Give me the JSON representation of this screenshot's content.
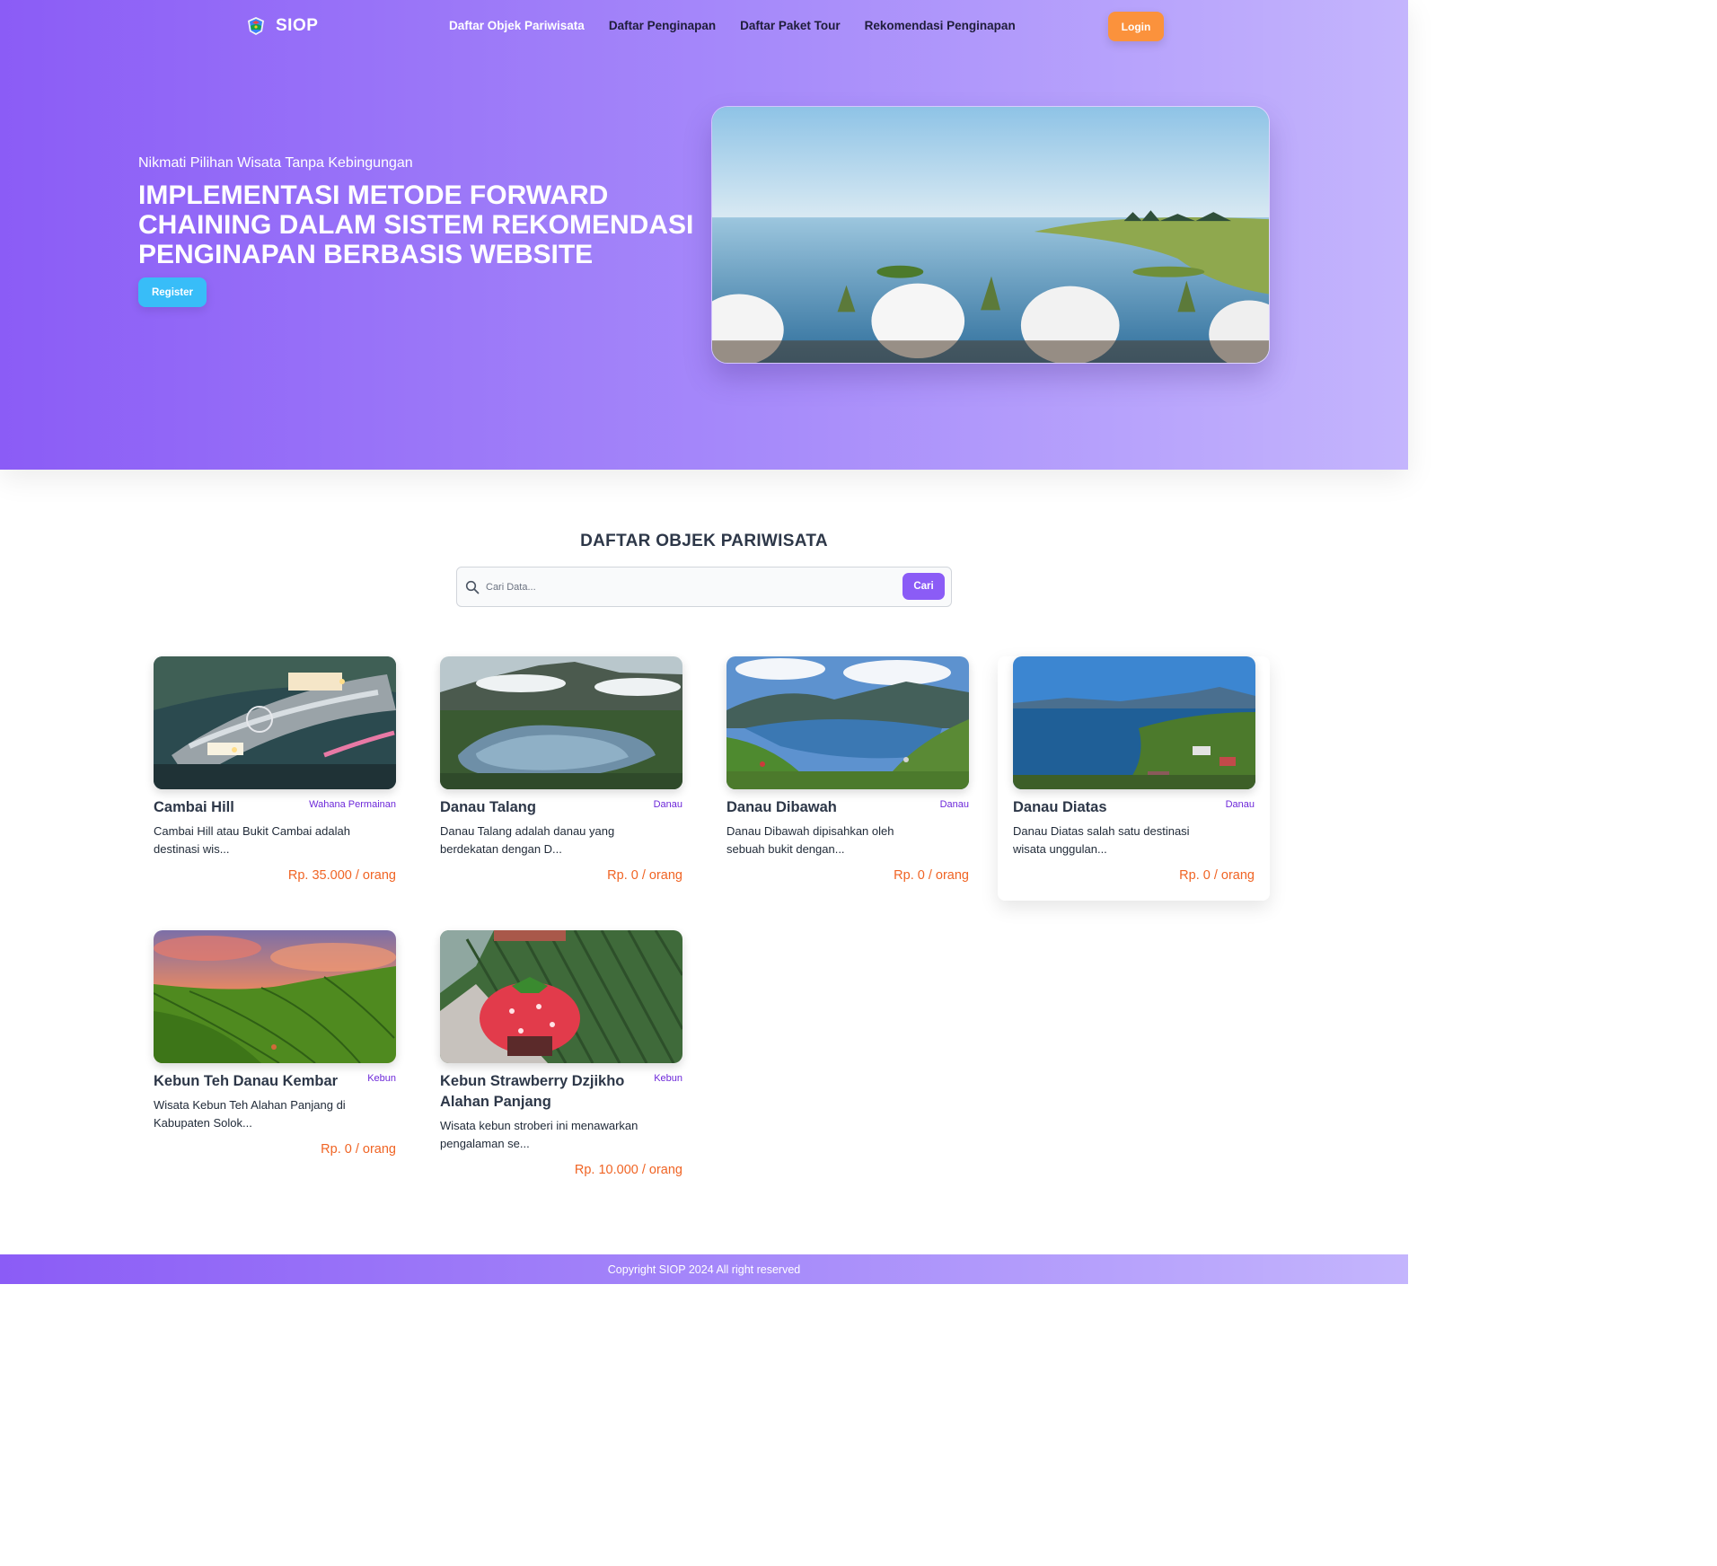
{
  "brand": {
    "name": "SIOP"
  },
  "nav": {
    "items": [
      {
        "label": "Daftar Objek Pariwisata"
      },
      {
        "label": "Daftar Penginapan"
      },
      {
        "label": "Daftar Paket Tour"
      },
      {
        "label": "Rekomendasi Penginapan"
      }
    ],
    "active_index": 0,
    "login_label": "Login"
  },
  "hero": {
    "subtitle": "Nikmati Pilihan Wisata Tanpa Kebingungan",
    "title": "IMPLEMENTASI METODE FORWARD CHAINING DALAM SISTEM REKOMENDASI PENGINAPAN BERBASIS WEBSITE",
    "register_label": "Register"
  },
  "section": {
    "title": "DAFTAR OBJEK PARIWISATA"
  },
  "search": {
    "placeholder": "Cari Data...",
    "value": "",
    "button_label": "Cari"
  },
  "cards": [
    {
      "title": "Cambai Hill",
      "category": "Wahana Permainan",
      "description": "Cambai Hill atau Bukit Cambai adalah destinasi wis...",
      "price": "Rp. 35.000 / orang"
    },
    {
      "title": "Danau Talang",
      "category": "Danau",
      "description": "Danau Talang adalah danau yang berdekatan dengan D...",
      "price": "Rp. 0 / orang"
    },
    {
      "title": "Danau Dibawah",
      "category": "Danau",
      "description": "Danau Dibawah dipisahkan oleh sebuah bukit dengan...",
      "price": "Rp. 0 / orang"
    },
    {
      "title": "Danau Diatas",
      "category": "Danau",
      "description": "Danau Diatas salah satu destinasi wisata unggulan...",
      "price": "Rp. 0 / orang"
    },
    {
      "title": "Kebun Teh Danau Kembar",
      "category": "Kebun",
      "description": "Wisata Kebun Teh Alahan Panjang di Kabupaten Solok...",
      "price": "Rp. 0 / orang"
    },
    {
      "title": "Kebun Strawberry Dzjikho Alahan Panjang",
      "category": "Kebun",
      "description": "Wisata kebun stroberi ini menawarkan pengalaman se...",
      "price": "Rp. 10.000 / orang"
    }
  ],
  "footer": {
    "text": "Copyright SIOP 2024 All right reserved"
  },
  "colors": {
    "accent": "#8b5cf6",
    "login": "#fb923c",
    "register": "#38bdf8",
    "price": "#f06424",
    "category": "#6d28d9"
  }
}
